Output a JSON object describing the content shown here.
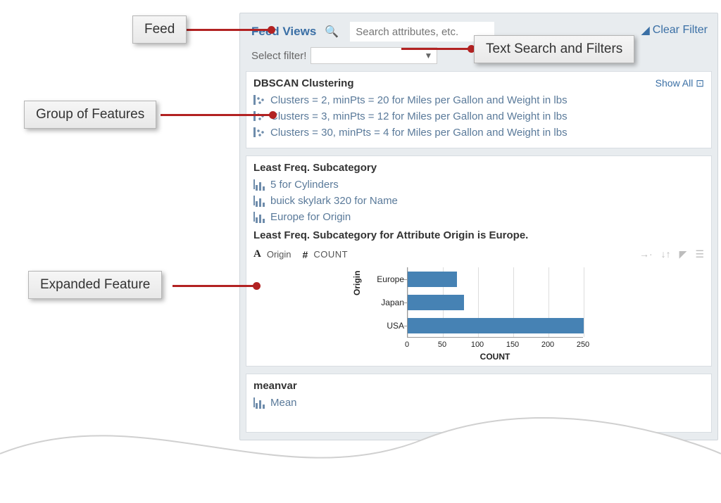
{
  "callouts": {
    "feed": "Feed",
    "text_search": "Text Search and Filters",
    "group_features": "Group of Features",
    "expanded_feature": "Expanded Feature"
  },
  "header": {
    "title": "Feed Views",
    "search_placeholder": "Search attributes, etc.",
    "clear_filter": "Clear Filter",
    "select_filter_label": "Select filter!"
  },
  "card1": {
    "title": "DBSCAN Clustering",
    "show_all": "Show All",
    "items": [
      "Clusters = 2, minPts = 20 for Miles per Gallon and Weight in lbs",
      "Clusters = 3, minPts = 12 for Miles per Gallon and Weight in lbs",
      "Clusters = 30, minPts = 4 for Miles per Gallon and Weight in lbs"
    ]
  },
  "card2": {
    "title": "Least Freq. Subcategory",
    "items": [
      "5 for Cylinders",
      "buick skylark 320 for Name",
      "Europe for Origin"
    ],
    "description": "Least Freq. Subcategory for Attribute Origin is Europe.",
    "field_a": "Origin",
    "field_b": "COUNT"
  },
  "card3": {
    "title": "meanvar",
    "item0": "Mean"
  },
  "chart_data": {
    "type": "bar",
    "orientation": "horizontal",
    "categories": [
      "Europe",
      "Japan",
      "USA"
    ],
    "values": [
      70,
      80,
      250
    ],
    "xlabel": "COUNT",
    "ylabel": "Origin",
    "xlim": [
      0,
      250
    ],
    "ticks": [
      0,
      50,
      100,
      150,
      200,
      250
    ],
    "color": "#4682b4"
  }
}
